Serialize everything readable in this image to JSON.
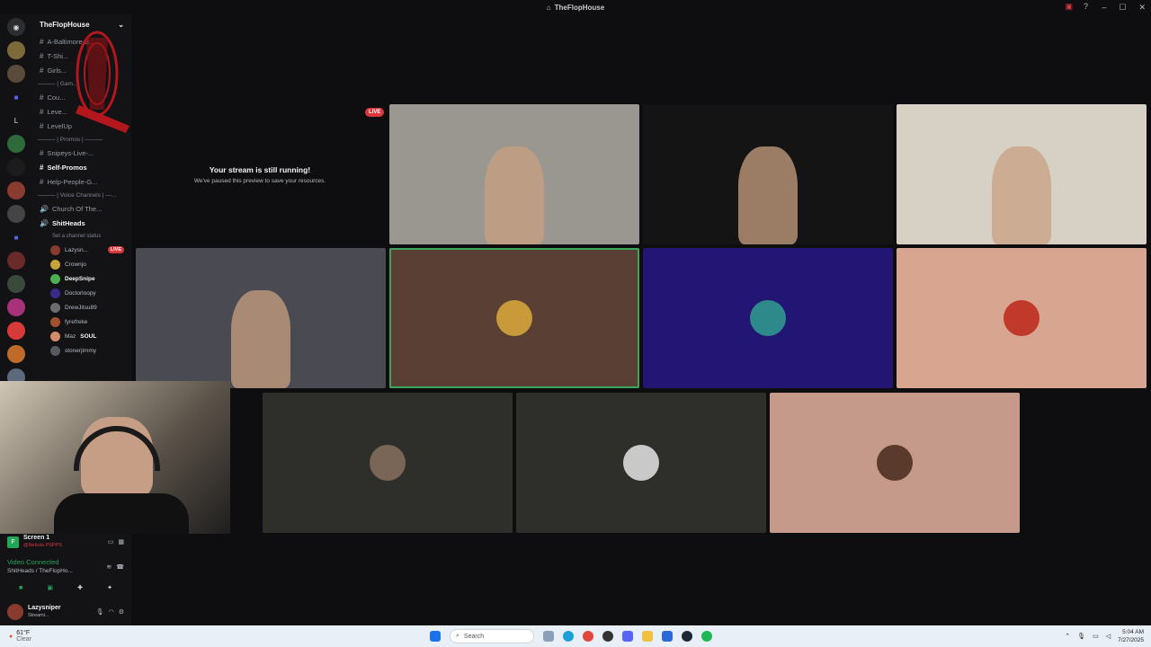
{
  "window": {
    "title": "TheFlopHouse"
  },
  "guild": {
    "name": "TheFlopHouse"
  },
  "channels": [
    {
      "kind": "text",
      "label": "A-Baltimore-B...",
      "bold": false
    },
    {
      "kind": "text",
      "label": "T-Shi...",
      "bold": false
    },
    {
      "kind": "text",
      "label": "Girls...",
      "bold": false
    },
    {
      "kind": "category",
      "label": "——— | Gam..."
    },
    {
      "kind": "text",
      "label": "Cou...",
      "bold": false
    },
    {
      "kind": "text",
      "label": "Leve...",
      "bold": false
    },
    {
      "kind": "text",
      "label": "LevelUp",
      "bold": false
    },
    {
      "kind": "category",
      "label": "——— | Promos | ———"
    },
    {
      "kind": "text",
      "label": "Snipeys-Live-...",
      "bold": false
    },
    {
      "kind": "text",
      "label": "Self-Promos",
      "bold": true
    },
    {
      "kind": "text",
      "label": "Help-People-G...",
      "bold": false
    },
    {
      "kind": "category",
      "label": "——— | Voice Channels | —..."
    },
    {
      "kind": "voice",
      "label": "Church Of The...",
      "bold": false
    },
    {
      "kind": "voice",
      "label": "ShitHeads",
      "bold": true
    }
  ],
  "voice_status_hint": "Set a channel status",
  "voice_users": [
    {
      "name": "Lazysn...",
      "live": true,
      "live_label": "LIVE",
      "color": "#8a3b2f"
    },
    {
      "name": "Crownjo",
      "live": false,
      "color": "#c8a23a"
    },
    {
      "name": "DeepSnipe",
      "live": false,
      "color": "#4caf50",
      "bold": true
    },
    {
      "name": "Doctorloopy",
      "live": false,
      "color": "#3b2a8a"
    },
    {
      "name": "DrewJitsu89",
      "live": false,
      "color": "#6b6b6b"
    },
    {
      "name": "fyrefreke",
      "live": false,
      "color": "#a0522d"
    },
    {
      "name": "Maz",
      "live": false,
      "color": "#d28b6a",
      "tag": "SOUL"
    },
    {
      "name": "stonerjimmy",
      "live": false,
      "color": "#555a60"
    }
  ],
  "stream_notice": {
    "title": "Your stream is still running!",
    "subtitle": "We've paused this preview to save your resources.",
    "live_label": "LIVE"
  },
  "tiles": [
    {
      "id": "streamer-1",
      "kind": "video",
      "bg": "#9a9690"
    },
    {
      "id": "streamer-2",
      "kind": "video",
      "bg": "#141414"
    },
    {
      "id": "streamer-3",
      "kind": "video",
      "bg": "#d7d0c4"
    },
    {
      "id": "streamer-4",
      "kind": "video",
      "bg": "#4a4a52"
    },
    {
      "id": "avatar-tile-1",
      "kind": "avatar",
      "bg": "#5a4034",
      "avatar_color": "#c89a3a",
      "speaking": true
    },
    {
      "id": "avatar-tile-2",
      "kind": "avatar",
      "bg": "#221574",
      "avatar_color": "#2e8a8a"
    },
    {
      "id": "avatar-tile-3",
      "kind": "avatar",
      "bg": "#d8a590",
      "avatar_color": "#c0392b"
    },
    {
      "id": "avatar-tile-4",
      "kind": "avatar",
      "bg": "#2e2f2b",
      "avatar_color": "#7a6656"
    },
    {
      "id": "avatar-tile-5",
      "kind": "avatar",
      "bg": "#2e2f2b",
      "avatar_color": "#c9c9c9"
    },
    {
      "id": "avatar-tile-6",
      "kind": "avatar",
      "bg": "#c69a8a",
      "avatar_color": "#5b3a2e"
    }
  ],
  "screen_share": {
    "label": "Screen 1",
    "sublabel": "@Nebula PSPPS"
  },
  "connection": {
    "status": "Video Connected",
    "channel": "ShitHeads / TheFlopHo..."
  },
  "user": {
    "name": "Lazysniper",
    "status": "Streami..."
  },
  "taskbar": {
    "weather_temp": "61°F",
    "weather_desc": "Clear",
    "search_placeholder": "Search",
    "time": "5:04 AM",
    "date": "7/27/2025"
  },
  "colors": {
    "accent_live": "#da373c",
    "speaking_border": "#3ba55c",
    "connected_green": "#23a55a"
  }
}
